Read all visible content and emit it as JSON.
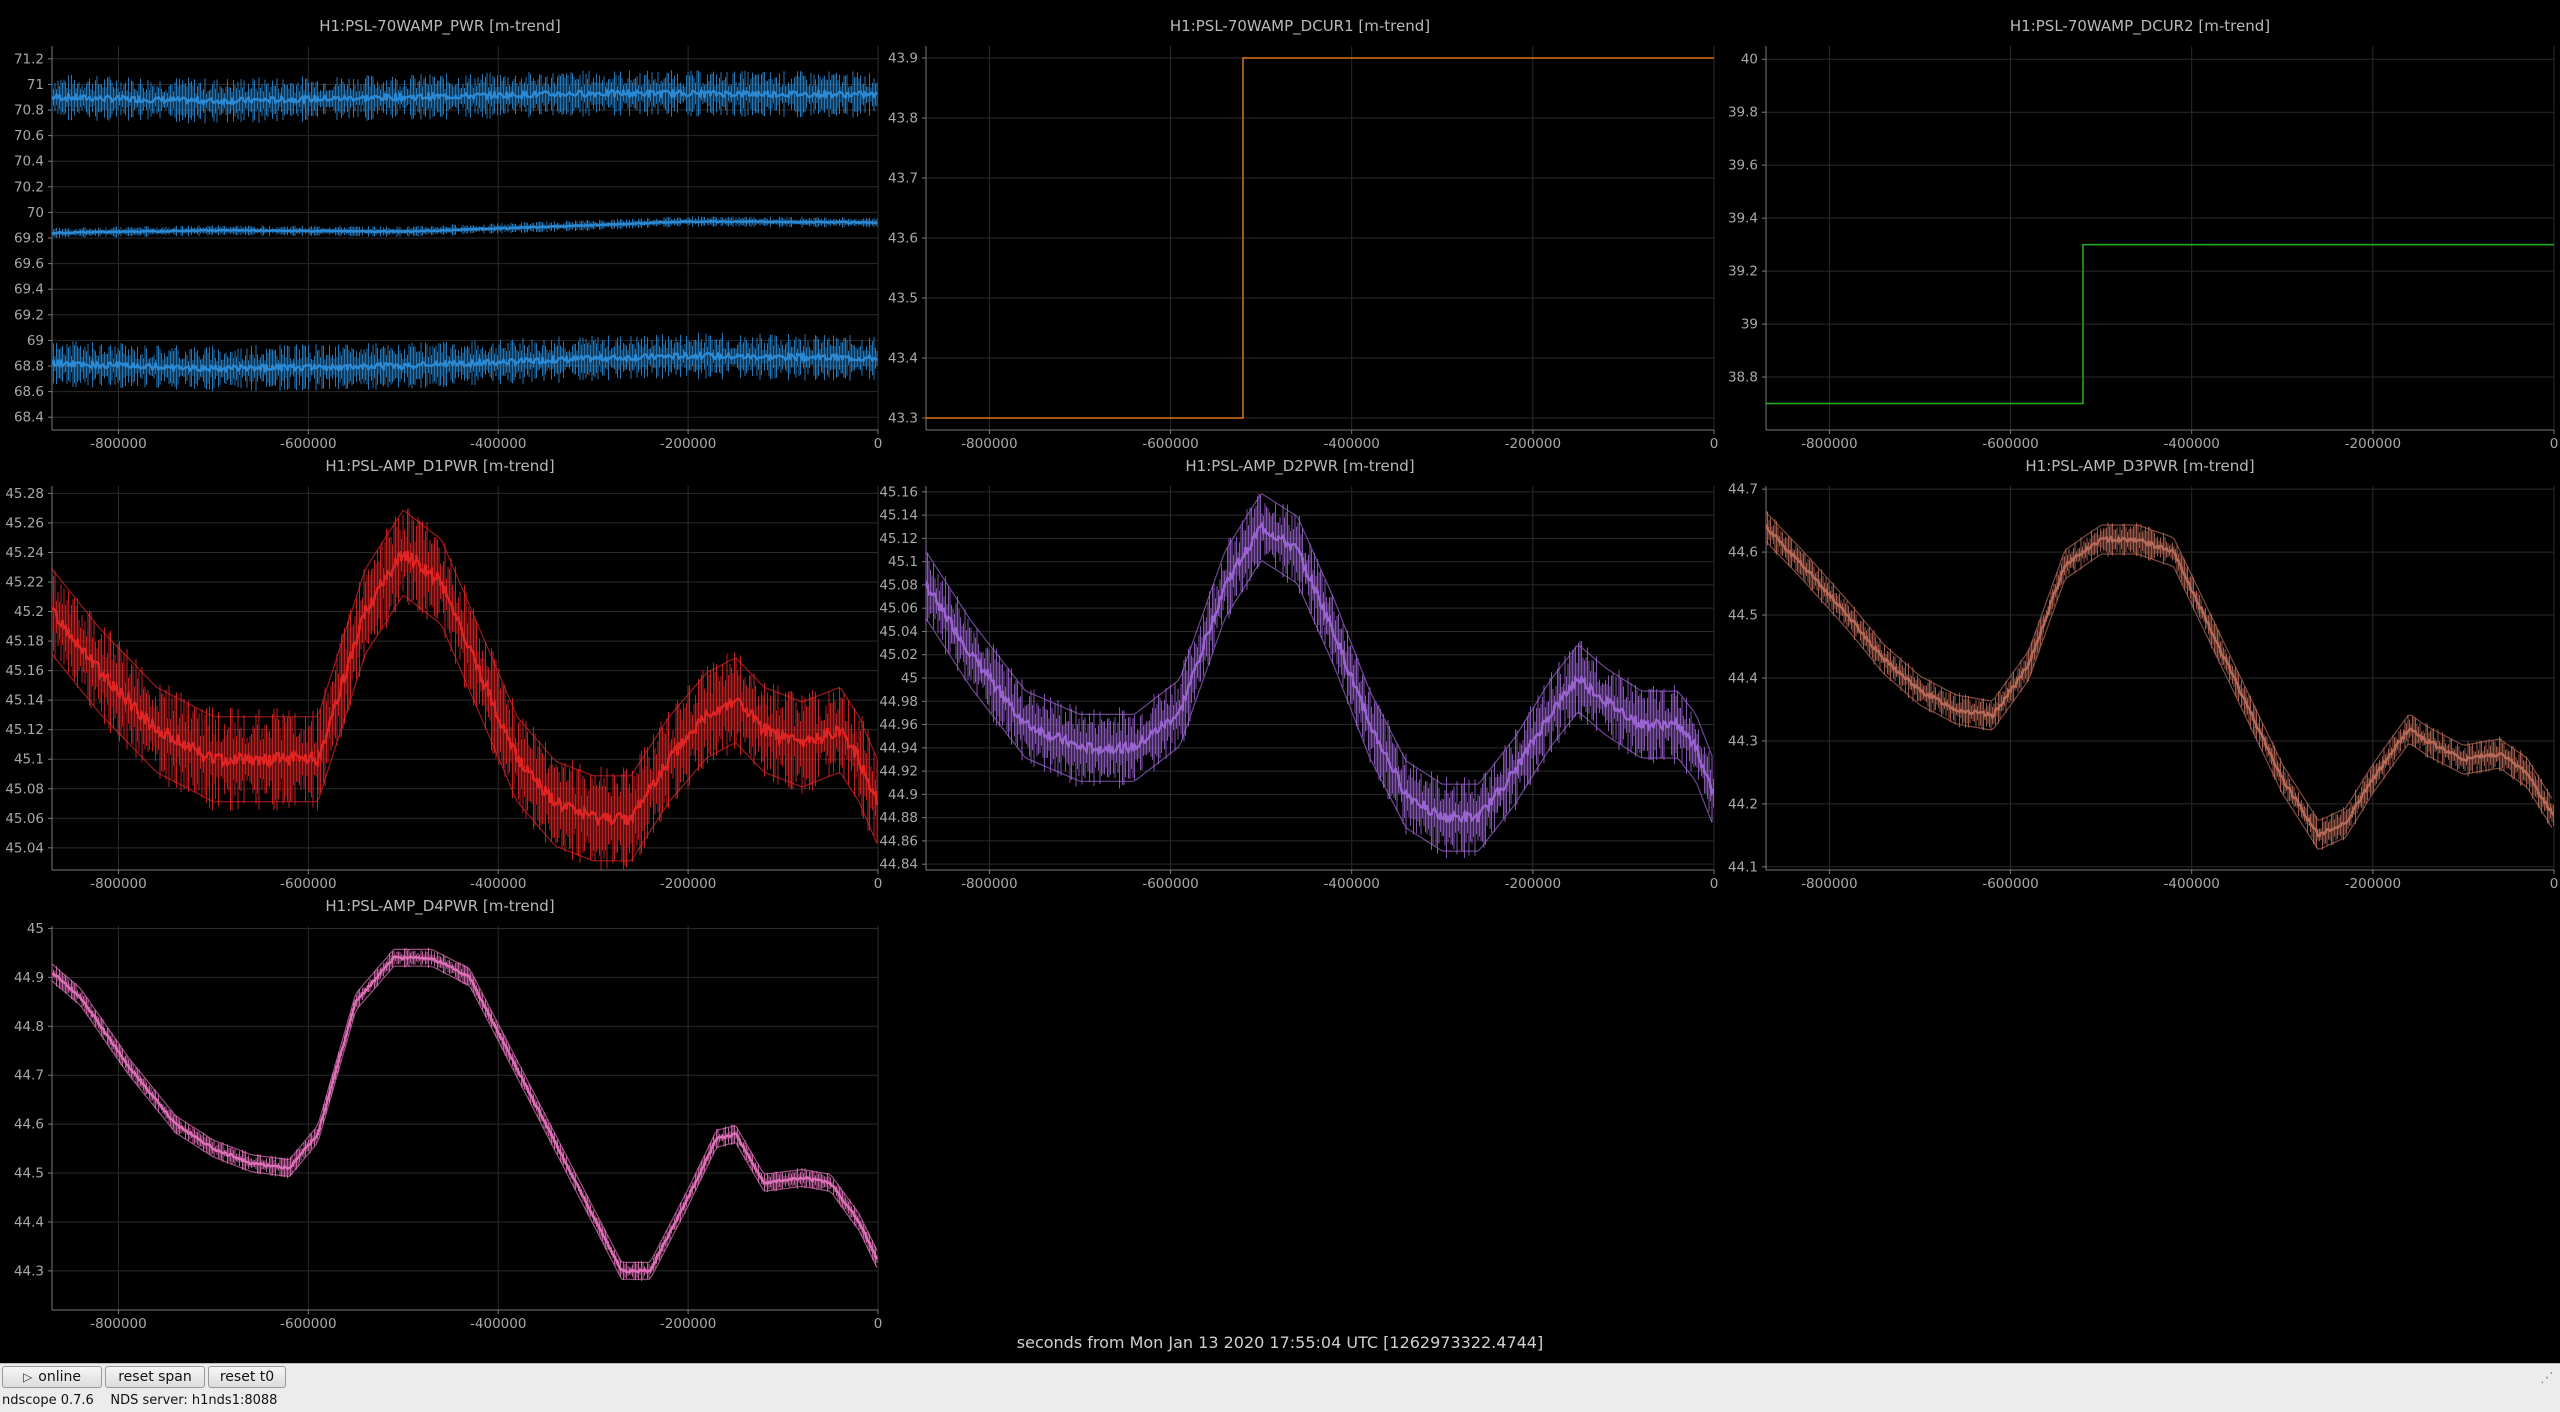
{
  "theme": {
    "background": "#000000",
    "grid": "#2a2a2a",
    "axis": "#7a7a7a",
    "text": "#b9b9b9"
  },
  "window": {
    "xlabel": "seconds from Mon Jan 13 2020 17:55:04 UTC [1262973322.4744]"
  },
  "buttons": {
    "online": "online",
    "online_icon": "play-icon",
    "reset_span": "reset span",
    "reset_t0": "reset t0"
  },
  "status": {
    "version": "ndscope 0.7.6",
    "server": "NDS server: h1nds1:8088"
  },
  "chart_data": [
    {
      "type": "line",
      "title": "H1:PSL-70WAMP_PWR [m-trend]",
      "color": "#2a8ad6",
      "xticks": [
        -800000,
        -600000,
        -400000,
        -200000,
        0
      ],
      "xlim": [
        -870000,
        0
      ],
      "ylim": [
        68.3,
        71.3
      ],
      "yticks": [
        68.4,
        68.6,
        68.8,
        69,
        69.2,
        69.4,
        69.6,
        69.8,
        70,
        70.2,
        70.4,
        70.6,
        70.8,
        71,
        71.2
      ],
      "series": [
        {
          "role": "max",
          "x": [
            -870000,
            -700000,
            -500000,
            -300000,
            -200000,
            0
          ],
          "y": [
            70.9,
            70.87,
            70.9,
            70.93,
            70.93,
            70.92
          ],
          "spread": 0.13
        },
        {
          "role": "mean",
          "x": [
            -870000,
            -700000,
            -500000,
            -300000,
            -200000,
            0
          ],
          "y": [
            69.84,
            69.86,
            69.85,
            69.9,
            69.93,
            69.92
          ],
          "spread": 0.03
        },
        {
          "role": "min",
          "x": [
            -870000,
            -700000,
            -500000,
            -300000,
            -200000,
            0
          ],
          "y": [
            68.82,
            68.78,
            68.8,
            68.86,
            68.88,
            68.86
          ],
          "spread": 0.13
        }
      ]
    },
    {
      "type": "line",
      "title": "H1:PSL-70WAMP_DCUR1 [m-trend]",
      "color": "#d9761c",
      "xticks": [
        -800000,
        -600000,
        -400000,
        -200000,
        0
      ],
      "xlim": [
        -870000,
        0
      ],
      "ylim": [
        43.28,
        43.92
      ],
      "yticks": [
        43.3,
        43.4,
        43.5,
        43.6,
        43.7,
        43.8,
        43.9
      ],
      "series": [
        {
          "role": "step",
          "x": [
            -870000,
            -520000,
            -520000,
            0
          ],
          "y": [
            43.3,
            43.3,
            43.9,
            43.9
          ],
          "spread": 0
        }
      ]
    },
    {
      "type": "line",
      "title": "H1:PSL-70WAMP_DCUR2 [m-trend]",
      "color": "#26b026",
      "xticks": [
        -800000,
        -600000,
        -400000,
        -200000,
        0
      ],
      "xlim": [
        -870000,
        0
      ],
      "ylim": [
        38.6,
        40.05
      ],
      "yticks": [
        38.8,
        39,
        39.2,
        39.4,
        39.6,
        39.8,
        40
      ],
      "series": [
        {
          "role": "step",
          "x": [
            -870000,
            -520000,
            -520000,
            0
          ],
          "y": [
            38.7,
            38.7,
            39.3,
            39.3
          ],
          "spread": 0
        }
      ]
    },
    {
      "type": "line",
      "title": "H1:PSL-AMP_D1PWR [m-trend]",
      "color": "#e02424",
      "xticks": [
        -800000,
        -600000,
        -400000,
        -200000,
        0
      ],
      "xlim": [
        -870000,
        0
      ],
      "ylim": [
        45.025,
        45.285
      ],
      "yticks": [
        45.04,
        45.06,
        45.08,
        45.1,
        45.12,
        45.14,
        45.16,
        45.18,
        45.2,
        45.22,
        45.24,
        45.26,
        45.28
      ],
      "series": [
        {
          "role": "mean",
          "x": [
            -870000,
            -820000,
            -760000,
            -700000,
            -640000,
            -590000,
            -540000,
            -500000,
            -460000,
            -420000,
            -380000,
            -340000,
            -300000,
            -260000,
            -220000,
            -180000,
            -150000,
            -120000,
            -80000,
            -40000,
            -20000,
            0
          ],
          "y": [
            45.2,
            45.16,
            45.12,
            45.1,
            45.1,
            45.1,
            45.2,
            45.24,
            45.22,
            45.16,
            45.1,
            45.07,
            45.06,
            45.06,
            45.1,
            45.13,
            45.14,
            45.12,
            45.11,
            45.12,
            45.1,
            45.07
          ],
          "spread": 0.025
        }
      ]
    },
    {
      "type": "line",
      "title": "H1:PSL-AMP_D2PWR [m-trend]",
      "color": "#9a64d0",
      "xticks": [
        -800000,
        -600000,
        -400000,
        -200000,
        0
      ],
      "xlim": [
        -870000,
        0
      ],
      "ylim": [
        44.835,
        45.165
      ],
      "yticks": [
        44.84,
        44.86,
        44.88,
        44.9,
        44.92,
        44.94,
        44.96,
        44.98,
        45.0,
        45.02,
        45.04,
        45.06,
        45.08,
        45.1,
        45.12,
        45.14,
        45.16
      ],
      "series": [
        {
          "role": "mean",
          "x": [
            -870000,
            -820000,
            -760000,
            -700000,
            -640000,
            -590000,
            -540000,
            -500000,
            -460000,
            -420000,
            -380000,
            -340000,
            -300000,
            -260000,
            -220000,
            -180000,
            -150000,
            -120000,
            -80000,
            -40000,
            -20000,
            0
          ],
          "y": [
            45.08,
            45.02,
            44.96,
            44.94,
            44.94,
            44.97,
            45.08,
            45.13,
            45.11,
            45.04,
            44.96,
            44.9,
            44.88,
            44.88,
            44.92,
            44.97,
            45.0,
            44.98,
            44.96,
            44.96,
            44.94,
            44.9
          ],
          "spread": 0.025
        }
      ]
    },
    {
      "type": "line",
      "title": "H1:PSL-AMP_D3PWR [m-trend]",
      "color": "#b86a58",
      "xticks": [
        -800000,
        -600000,
        -400000,
        -200000,
        0
      ],
      "xlim": [
        -870000,
        0
      ],
      "ylim": [
        44.095,
        44.705
      ],
      "yticks": [
        44.1,
        44.2,
        44.3,
        44.4,
        44.5,
        44.6,
        44.7
      ],
      "series": [
        {
          "role": "mean",
          "x": [
            -870000,
            -830000,
            -780000,
            -740000,
            -700000,
            -660000,
            -620000,
            -580000,
            -540000,
            -500000,
            -460000,
            -420000,
            -380000,
            -340000,
            -300000,
            -260000,
            -230000,
            -200000,
            -160000,
            -140000,
            -100000,
            -60000,
            -30000,
            0
          ],
          "y": [
            44.64,
            44.58,
            44.5,
            44.43,
            44.38,
            44.35,
            44.34,
            44.42,
            44.58,
            44.62,
            44.62,
            44.6,
            44.48,
            44.36,
            44.24,
            44.15,
            44.17,
            44.24,
            44.32,
            44.3,
            44.27,
            44.28,
            44.25,
            44.18
          ],
          "spread": 0.02
        }
      ]
    },
    {
      "type": "line",
      "title": "H1:PSL-AMP_D4PWR [m-trend]",
      "color": "#e070b8",
      "xticks": [
        -800000,
        -600000,
        -400000,
        -200000,
        0
      ],
      "xlim": [
        -870000,
        0
      ],
      "ylim": [
        44.22,
        45.005
      ],
      "yticks": [
        44.3,
        44.4,
        44.5,
        44.6,
        44.7,
        44.8,
        44.9,
        45
      ],
      "series": [
        {
          "role": "mean",
          "x": [
            -870000,
            -840000,
            -790000,
            -740000,
            -700000,
            -660000,
            -620000,
            -590000,
            -550000,
            -510000,
            -470000,
            -430000,
            -390000,
            -350000,
            -310000,
            -270000,
            -240000,
            -200000,
            -170000,
            -150000,
            -120000,
            -80000,
            -50000,
            -20000,
            0
          ],
          "y": [
            44.91,
            44.86,
            44.72,
            44.6,
            44.55,
            44.52,
            44.51,
            44.58,
            44.85,
            44.94,
            44.94,
            44.9,
            44.75,
            44.6,
            44.45,
            44.3,
            44.3,
            44.45,
            44.57,
            44.58,
            44.48,
            44.49,
            44.48,
            44.4,
            44.32
          ],
          "spread": 0.015
        }
      ]
    }
  ]
}
